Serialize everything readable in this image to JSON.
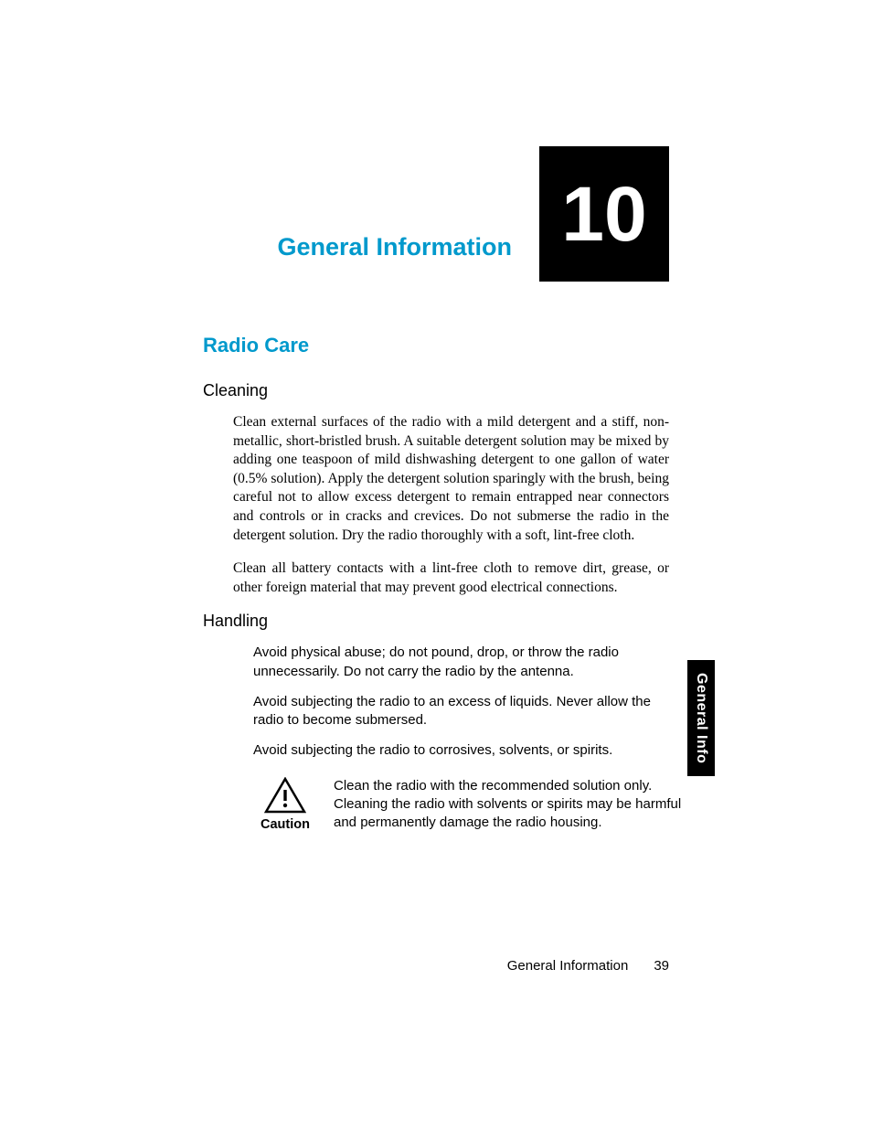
{
  "chapter": {
    "title": "General Information",
    "number": "10"
  },
  "section": {
    "radio_care": "Radio Care",
    "cleaning": {
      "heading": "Cleaning",
      "p1": "Clean external surfaces of the radio with a mild detergent and a stiff, non-metallic, short-bristled brush. A suitable detergent solution may be mixed by adding one teaspoon of mild dishwashing detergent to one gallon of water (0.5% solution). Apply the detergent solution sparingly with the brush, being careful not to allow excess detergent to remain entrapped near connectors and controls or in cracks and crevices. Do not submerse the radio in the detergent solution. Dry the radio thoroughly with a soft, lint-free cloth.",
      "p2": "Clean all battery contacts with a lint-free cloth to remove dirt, grease, or other foreign material that may prevent good electrical connections."
    },
    "handling": {
      "heading": "Handling",
      "p1": "Avoid physical abuse; do not pound, drop, or throw the radio unnecessarily. Do not carry the radio by the antenna.",
      "p2": "Avoid subjecting the radio to an excess of liquids. Never allow the radio to become submersed.",
      "p3": "Avoid subjecting the radio to corrosives, solvents, or spirits."
    },
    "caution": {
      "label": "Caution",
      "text": "Clean the radio with the recommended solution only. Cleaning the radio with solvents or spirits may be harmful and permanently damage the radio housing."
    }
  },
  "side_tab": "General Info",
  "footer": {
    "section": "General Information",
    "page": "39"
  }
}
